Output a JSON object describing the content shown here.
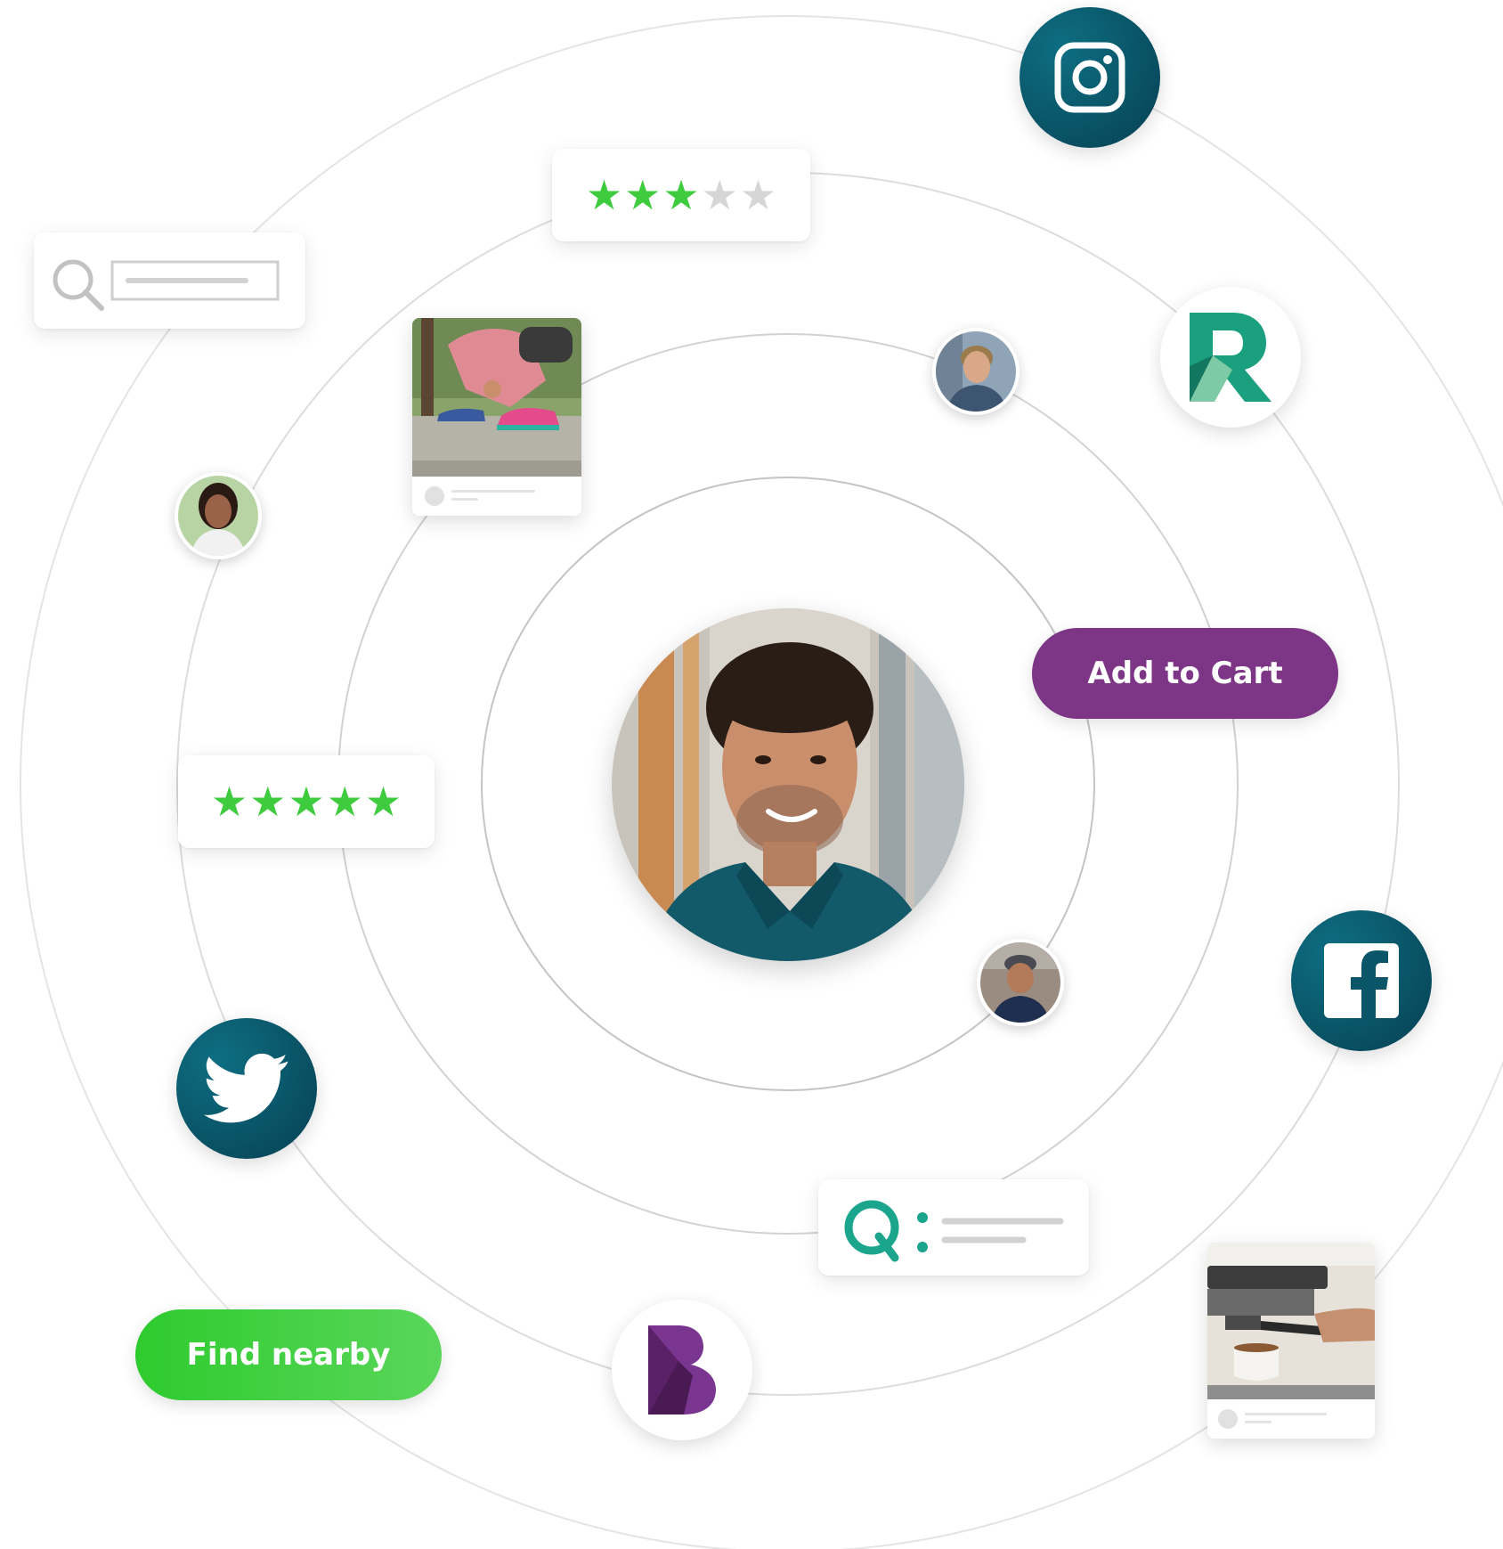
{
  "center": {
    "subject": "smiling-man-portrait"
  },
  "buttons": {
    "add_to_cart": {
      "label": "Add to Cart",
      "color": "#7d3586"
    },
    "find_nearby": {
      "label": "Find nearby",
      "color": "#3ccd3c"
    }
  },
  "ratings": {
    "top": {
      "value": 3,
      "max": 5
    },
    "left": {
      "value": 5,
      "max": 5
    },
    "filled_color": "#3ecb3e",
    "empty_color": "#d6d6d6"
  },
  "social_icons": [
    "instagram-icon",
    "facebook-icon",
    "twitter-icon"
  ],
  "brand_logos": [
    "r-logo",
    "b-logo"
  ],
  "colors": {
    "ring": "#d4d4d4",
    "inner_ring": "#bdbdbd",
    "social_bg": "#0a5568",
    "brand_green": "#1aa07e",
    "brand_purple": "#6a2a7a"
  }
}
